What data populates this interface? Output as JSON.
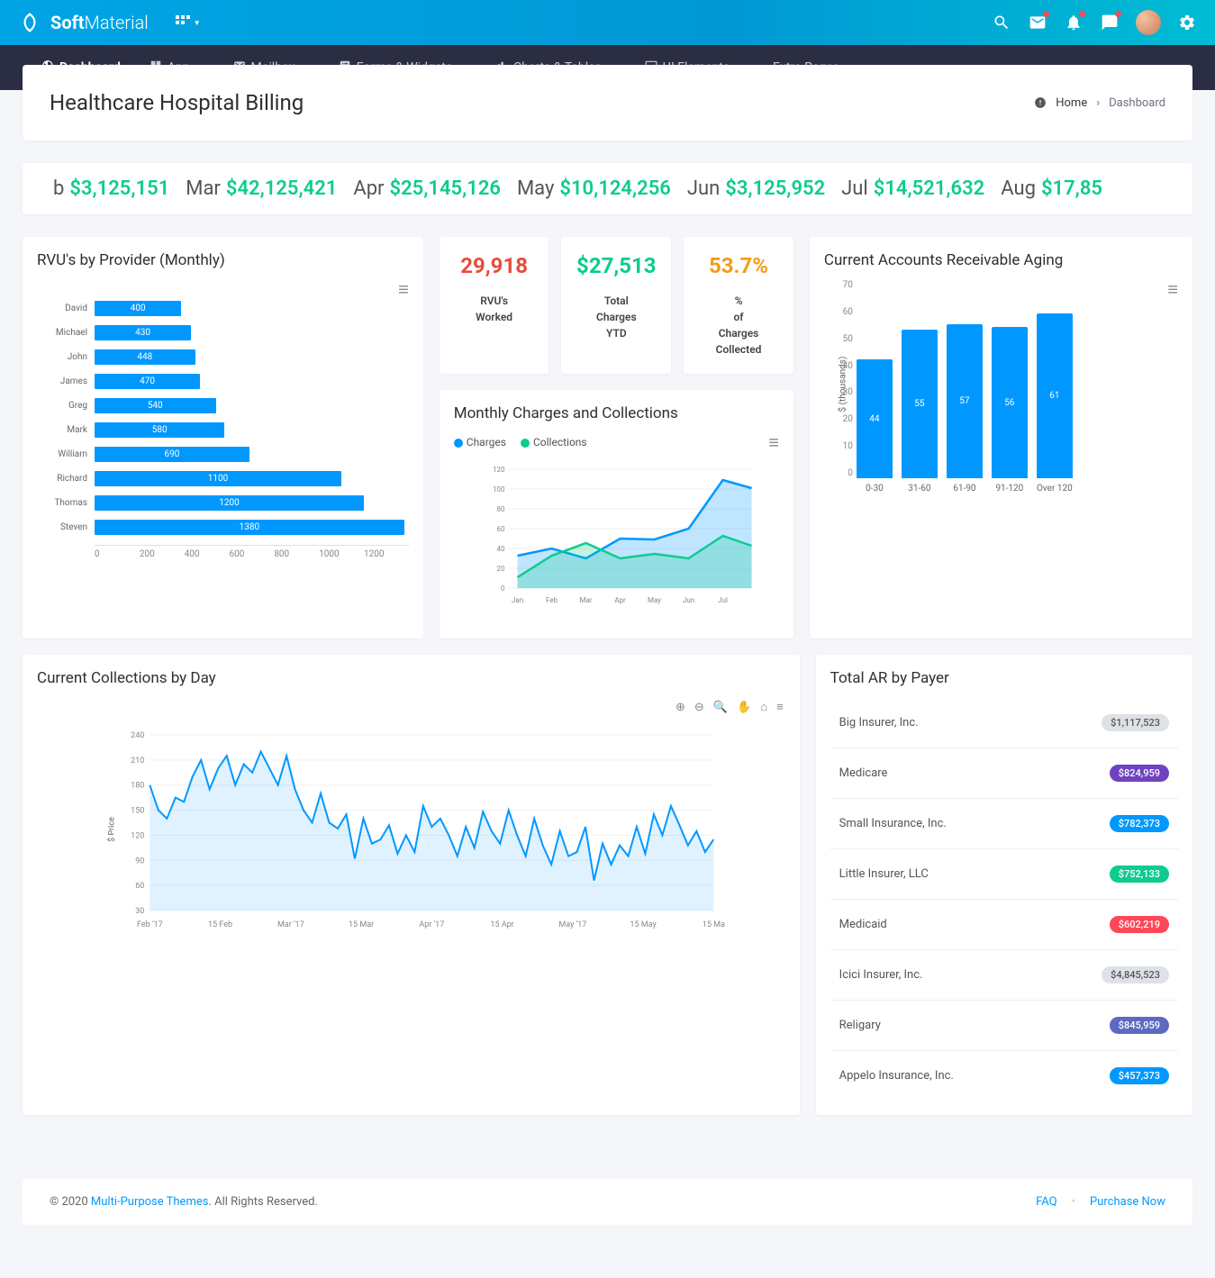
{
  "app": {
    "brand_strong": "Soft",
    "brand_light": "Material"
  },
  "nav": [
    {
      "label": "Dashboard",
      "icon": "dashboard",
      "active": true
    },
    {
      "label": "App",
      "icon": "grid",
      "caret": true
    },
    {
      "label": "Mailbox",
      "icon": "mail",
      "caret": true
    },
    {
      "label": "Forms & Widgets",
      "icon": "form",
      "caret": true
    },
    {
      "label": "Charts & Tables",
      "icon": "chart",
      "caret": true
    },
    {
      "label": "UI Elements",
      "icon": "ui",
      "caret": true
    },
    {
      "label": "Extra Pages",
      "icon": "",
      "caret": true
    }
  ],
  "page": {
    "title": "Healthcare Hospital Billing"
  },
  "breadcrumb": {
    "home": "Home",
    "current": "Dashboard",
    "sep": "›"
  },
  "ticker": [
    {
      "month": "b",
      "value": "$3,125,151"
    },
    {
      "month": "Mar",
      "value": "$42,125,421"
    },
    {
      "month": "Apr",
      "value": "$25,145,126"
    },
    {
      "month": "May",
      "value": "$10,124,256"
    },
    {
      "month": "Jun",
      "value": "$3,125,952"
    },
    {
      "month": "Jul",
      "value": "$14,521,632"
    },
    {
      "month": "Aug",
      "value": "$17,85"
    }
  ],
  "stats": [
    {
      "value": "29,918",
      "label": "RVU's Worked",
      "color": "c-red"
    },
    {
      "value": "$27,513",
      "label": "Total Charges YTD",
      "color": "c-green"
    },
    {
      "value": "53.7%",
      "label": "% of Charges Collected",
      "color": "c-orange"
    }
  ],
  "cards": {
    "rvu_title": "RVU's by Provider (Monthly)",
    "monthly_title": "Monthly Charges and Collections",
    "ar_aging_title": "Current Accounts Receivable Aging",
    "ar_payer_title": "Total AR by Payer",
    "collections_title": "Current Collections by Day"
  },
  "legend": {
    "charges": "Charges",
    "collections": "Collections"
  },
  "payers": [
    {
      "name": "Big Insurer, Inc.",
      "amount": "$1,117,523",
      "cls": "bg-gray"
    },
    {
      "name": "Medicare",
      "amount": "$824,959",
      "cls": "bg-purple"
    },
    {
      "name": "Small Insurance, Inc.",
      "amount": "$782,373",
      "cls": "bg-blue"
    },
    {
      "name": "Little Insurer, LLC",
      "amount": "$752,133",
      "cls": "bg-green"
    },
    {
      "name": "Medicaid",
      "amount": "$602,219",
      "cls": "bg-red"
    },
    {
      "name": "Icici Insurer, Inc.",
      "amount": "$4,845,523",
      "cls": "bg-gray"
    },
    {
      "name": "Religary",
      "amount": "$845,959",
      "cls": "bg-indigo"
    },
    {
      "name": "Appelo Insurance, Inc.",
      "amount": "$457,373",
      "cls": "bg-blue"
    }
  ],
  "footer": {
    "copyright": "© 2020 ",
    "company": "Multi-Purpose Themes",
    "rights": ". All Rights Reserved.",
    "faq": "FAQ",
    "purchase": "Purchase Now"
  },
  "axis": {
    "collections_y": "$ Price",
    "aging_y": "$ (thousands)"
  },
  "chart_data": [
    {
      "id": "rvu_provider",
      "type": "bar",
      "orientation": "horizontal",
      "title": "RVU's by Provider (Monthly)",
      "categories": [
        "David",
        "Michael",
        "John",
        "James",
        "Greg",
        "Mark",
        "William",
        "Richard",
        "Thomas",
        "Steven"
      ],
      "values": [
        400,
        430,
        448,
        470,
        540,
        580,
        690,
        1100,
        1200,
        1380
      ],
      "xlim": [
        0,
        1400
      ],
      "x_ticks": [
        0,
        200,
        400,
        600,
        800,
        1000,
        1200
      ]
    },
    {
      "id": "monthly_charges_collections",
      "type": "area",
      "title": "Monthly Charges and Collections",
      "categories": [
        "Jan",
        "Feb",
        "Mar",
        "Apr",
        "May",
        "Jun",
        "Jul"
      ],
      "series": [
        {
          "name": "Charges",
          "color": "#0098ff",
          "values": [
            32,
            40,
            30,
            50,
            49,
            60,
            108,
            100
          ]
        },
        {
          "name": "Collections",
          "color": "#0ecb8f",
          "values": [
            11,
            32,
            45,
            30,
            34,
            30,
            52,
            42
          ]
        }
      ],
      "ylim": [
        0,
        120
      ],
      "y_ticks": [
        0,
        20,
        40,
        60,
        80,
        100,
        120
      ]
    },
    {
      "id": "ar_aging",
      "type": "bar",
      "title": "Current Accounts Receivable Aging",
      "ylabel": "$ (thousands)",
      "categories": [
        "0-30",
        "31-60",
        "61-90",
        "91-120",
        "Over 120"
      ],
      "values": [
        44,
        55,
        57,
        56,
        61
      ],
      "ylim": [
        0,
        70
      ],
      "y_ticks": [
        0,
        10,
        20,
        30,
        40,
        50,
        60,
        70
      ]
    },
    {
      "id": "collections_by_day",
      "type": "line",
      "title": "Current Collections by Day",
      "ylabel": "$ Price",
      "x_ticks": [
        "Feb '17",
        "15 Feb",
        "Mar '17",
        "15 Mar",
        "Apr '17",
        "15 Apr",
        "May '17",
        "15 May",
        "15 Ma"
      ],
      "y_ticks": [
        30,
        60,
        90,
        120,
        150,
        180,
        210,
        240
      ],
      "ylim": [
        30,
        240
      ],
      "values": [
        180,
        150,
        140,
        165,
        160,
        190,
        210,
        175,
        200,
        215,
        180,
        205,
        195,
        220,
        200,
        180,
        215,
        175,
        150,
        135,
        170,
        135,
        128,
        145,
        92,
        140,
        110,
        115,
        132,
        98,
        120,
        100,
        155,
        130,
        140,
        120,
        95,
        130,
        105,
        148,
        125,
        110,
        150,
        120,
        95,
        140,
        108,
        85,
        125,
        95,
        100,
        130,
        66,
        110,
        85,
        108,
        95,
        130,
        98,
        145,
        120,
        155,
        132,
        108,
        125,
        100,
        115
      ]
    }
  ]
}
